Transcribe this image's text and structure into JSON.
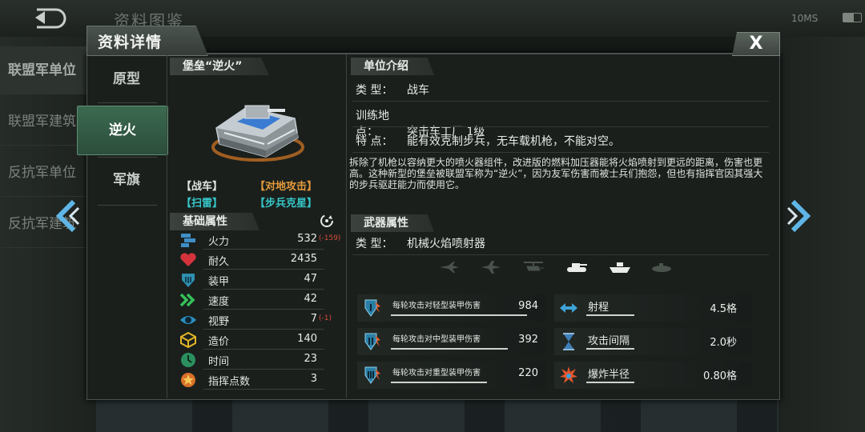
{
  "background": {
    "title": "资料图鉴",
    "status": "10MS",
    "nav_items": [
      "联盟军单位",
      "联盟军建筑",
      "反抗军单位",
      "反抗军建筑"
    ]
  },
  "dialog": {
    "title": "资料详情",
    "close_label": "X"
  },
  "tabs": [
    {
      "label": "原型",
      "active": false
    },
    {
      "label": "逆火",
      "active": true
    },
    {
      "label": "军旗",
      "active": false
    }
  ],
  "unit": {
    "name": "堡垒“逆火”",
    "tags": [
      {
        "text": "【战车】",
        "color": "white"
      },
      {
        "text": "【对地攻击】",
        "color": "orange"
      },
      {
        "text": "【扫雷】",
        "color": "cyan"
      },
      {
        "text": "【步兵克星】",
        "color": "cyan"
      }
    ]
  },
  "basic_stats": {
    "header": "基础属性",
    "rows": [
      {
        "icon": "firepower-icon",
        "label": "火力",
        "value": "532",
        "delta": "(-159)"
      },
      {
        "icon": "heart-icon",
        "label": "耐久",
        "value": "2435",
        "delta": ""
      },
      {
        "icon": "armor-shield-icon",
        "label": "装甲",
        "value": "47",
        "delta": ""
      },
      {
        "icon": "speed-chevrons-icon",
        "label": "速度",
        "value": "42",
        "delta": ""
      },
      {
        "icon": "eye-icon",
        "label": "视野",
        "value": "7",
        "delta": "(-1)"
      },
      {
        "icon": "cube-cost-icon",
        "label": "造价",
        "value": "140",
        "delta": ""
      },
      {
        "icon": "clock-icon",
        "label": "时间",
        "value": "23",
        "delta": ""
      },
      {
        "icon": "command-star-icon",
        "label": "指挥点数",
        "value": "3",
        "delta": ""
      }
    ]
  },
  "intro": {
    "header": "单位介绍",
    "type_key": "类    型：",
    "type_val": "战车",
    "train_key": "训练地点：",
    "train_val": "突击车工厂 1级",
    "feature_key": "特    点：",
    "feature_val": "能有效克制步兵，无车载机枪，不能对空。",
    "description": "拆除了机枪以容纳更大的喷火器组件，改进版的燃料加压器能将火焰喷射到更远的距离，伤害也更高。这种新型的堡垒被联盟军称为“逆火”，因为友军伤害而被士兵们抱怨，但也有指挥官因其强大的步兵驱赶能力而使用它。"
  },
  "weapon": {
    "header": "武器属性",
    "type_key": "类    型：",
    "type_val": "机械火焰喷射器",
    "targets": [
      {
        "icon": "fighter-jet-icon",
        "on": false
      },
      {
        "icon": "bomber-plane-icon",
        "on": false
      },
      {
        "icon": "helicopter-icon",
        "on": false
      },
      {
        "icon": "tank-icon",
        "on": true
      },
      {
        "icon": "ship-icon",
        "on": true
      },
      {
        "icon": "submarine-icon",
        "on": false
      }
    ],
    "damage_cards": [
      {
        "icon": "armor-class-1-icon",
        "label": "每轮攻击对轻型装甲伤害",
        "value": "984"
      },
      {
        "icon": "armor-class-2-icon",
        "label": "每轮攻击对中型装甲伤害",
        "value": "392"
      },
      {
        "icon": "armor-class-3-icon",
        "label": "每轮攻击对重型装甲伤害",
        "value": "220"
      }
    ],
    "spec_cards": [
      {
        "icon": "range-arrows-icon",
        "label": "射程",
        "value": "4.5格"
      },
      {
        "icon": "hourglass-icon",
        "label": "攻击间隔",
        "value": "2.0秒"
      },
      {
        "icon": "explosion-icon",
        "label": "爆炸半径",
        "value": "0.80格"
      }
    ]
  }
}
